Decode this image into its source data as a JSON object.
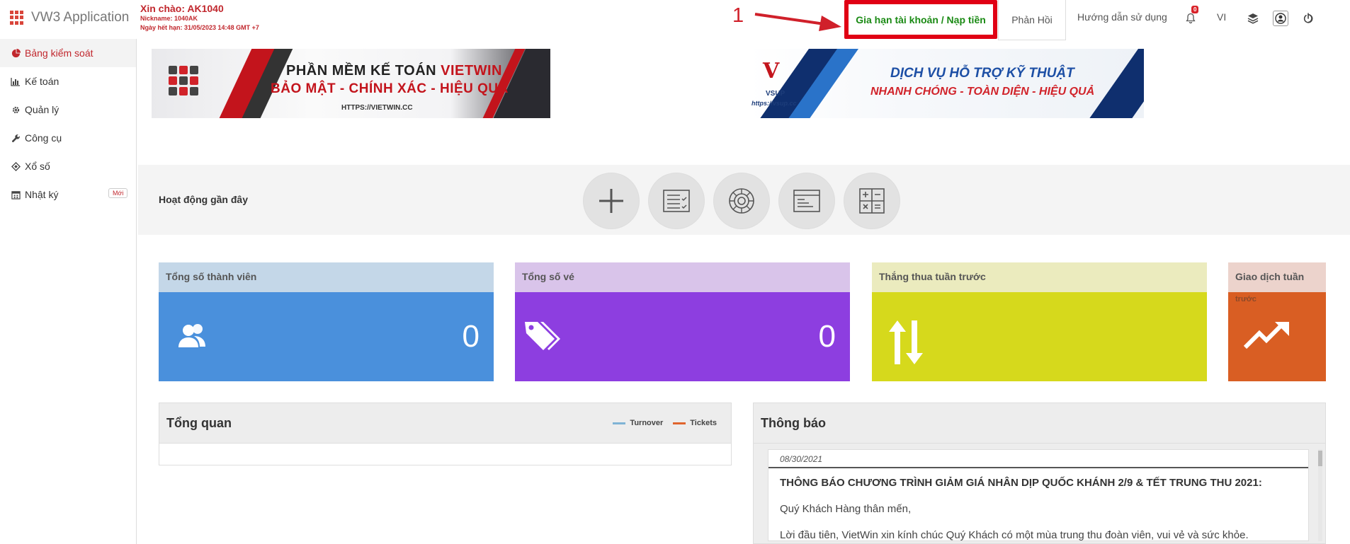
{
  "app": {
    "title": "VW3 Application"
  },
  "user": {
    "greeting": "Xin chào: AK1040",
    "nickname": "Nickname: 1040AK",
    "expiry": "Ngày hết hạn: 31/05/2023 14:48 GMT +7"
  },
  "annotation": {
    "number": "1"
  },
  "header": {
    "renew_label": "Gia hạn tài khoản / Nạp tiền",
    "feedback_label": "Phản Hồi",
    "guide_label": "Hướng dẫn sử dụng",
    "notifications_count": "0",
    "language": "VI"
  },
  "sidebar": {
    "items": [
      {
        "label": "Bảng kiểm soát",
        "icon": "pie-chart-icon"
      },
      {
        "label": "Kế toán",
        "icon": "bar-chart-icon"
      },
      {
        "label": "Quản lý",
        "icon": "gear-icon"
      },
      {
        "label": "Công cụ",
        "icon": "wrench-icon"
      },
      {
        "label": "Xổ số",
        "icon": "ticket-icon"
      },
      {
        "label": "Nhật ký",
        "icon": "calendar-icon"
      }
    ],
    "new_badge": "Mới"
  },
  "banners": {
    "vietwin": {
      "line1_prefix": "PHẦN MỀM KẾ TOÁN ",
      "line1_brand": "VIETWIN",
      "line2": "BẢO MẬT - CHÍNH XÁC - HIỆU QUẢ",
      "url": "HTTPS://VIETWIN.CC"
    },
    "vsup": {
      "logo_text": "VSUP",
      "url": "https://vsup.cc",
      "line1": "DỊCH VỤ HỖ TRỢ KỸ THUẬT",
      "line2": "NHANH CHÓNG - TOÀN DIỆN - HIỆU QUẢ"
    }
  },
  "activity": {
    "title": "Hoạt động gần đây",
    "buttons": [
      "add-icon",
      "checklist-icon",
      "roulette-icon",
      "window-list-icon",
      "calculator-icon"
    ]
  },
  "stats": [
    {
      "label": "Tổng số thành viên",
      "value": "0",
      "head_color": "#c4d7e8",
      "body_color": "#4a90dc",
      "icon": "users-icon"
    },
    {
      "label": "Tổng số vé",
      "value": "0",
      "head_color": "#d9c4ea",
      "body_color": "#8d3ee0",
      "icon": "tags-icon"
    },
    {
      "label": "Thắng thua tuần trước",
      "value": "",
      "head_color": "#ebebbe",
      "body_color": "#d6d91c",
      "icon": "up-down-arrows-icon"
    },
    {
      "label": "Giao dịch tuần",
      "label2": "trước",
      "value": "",
      "head_color": "#ecd3cc",
      "body_color": "#d95e23",
      "icon": "trend-up-icon"
    }
  ],
  "overview": {
    "title": "Tổng quan",
    "legend": [
      {
        "name": "Turnover",
        "color": "#7fb3d5"
      },
      {
        "name": "Tickets",
        "color": "#e0652e"
      }
    ]
  },
  "notice": {
    "title": "Thông báo",
    "date": "08/30/2021",
    "headline": "THÔNG BÁO CHƯƠNG TRÌNH GIẢM GIÁ NHÂN DỊP QUỐC KHÁNH 2/9 & TẾT TRUNG THU 2021:",
    "salutation": "Quý Khách Hàng thân mến,",
    "body": "Lời đầu tiên, VietWin xin kính chúc Quý Khách có một mùa trung thu đoàn viên, vui vẻ và sức khỏe."
  }
}
